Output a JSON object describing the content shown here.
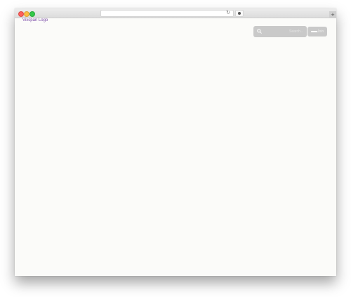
{
  "site": {
    "logo_alt": "Vixspan Logo"
  },
  "header": {
    "search_placeholder": "Search...",
    "login_label": "Join"
  },
  "browser": {
    "reload_icon": "reload-icon",
    "extension_icon": "extension-icon",
    "new_tab_icon": "new-tab-icon"
  },
  "colors": {
    "page_background": "#fbfbf9",
    "header_controls": "#c9c9c9",
    "logo_text": "#7a4aa8"
  }
}
